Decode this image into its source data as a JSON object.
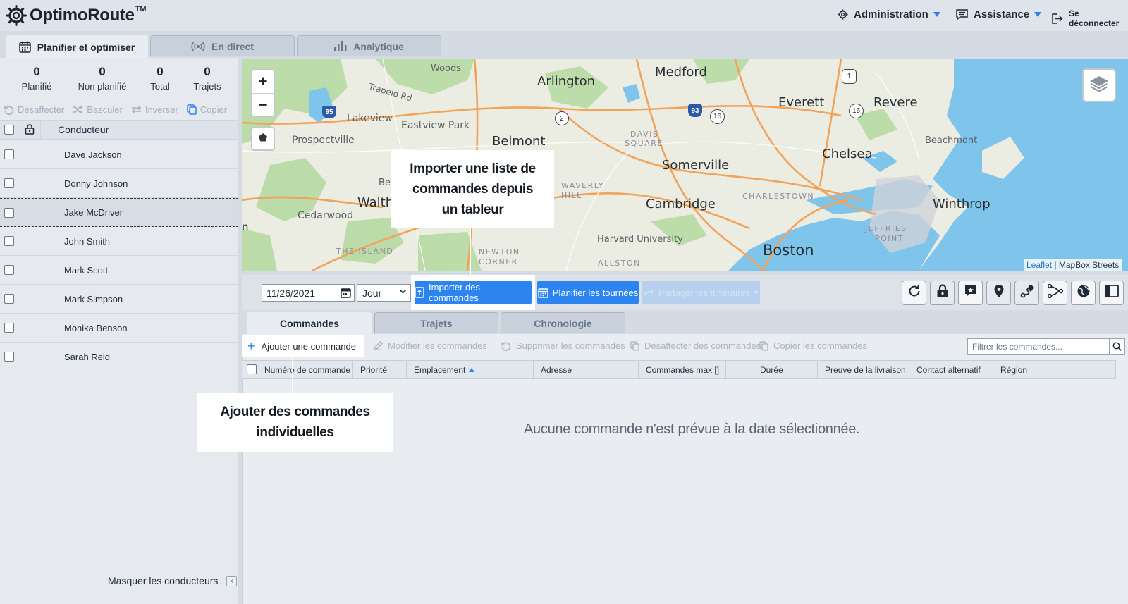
{
  "app": {
    "name": "OptimoRoute",
    "tm": "TM"
  },
  "top_menu": {
    "administration": "Administration",
    "assistance": "Assistance",
    "logout": "Se déconnecter"
  },
  "main_tabs": [
    {
      "label": "Planifier et optimiser",
      "active": true
    },
    {
      "label": "En direct",
      "active": false
    },
    {
      "label": "Analytique",
      "active": false
    }
  ],
  "stats": [
    {
      "value": "0",
      "label": "Planifié"
    },
    {
      "value": "0",
      "label": "Non planifié"
    },
    {
      "value": "0",
      "label": "Total"
    },
    {
      "value": "0",
      "label": "Trajets"
    }
  ],
  "driver_actions": {
    "unassign": "Désaffecter",
    "toggle": "Basculer",
    "invert": "Inverser",
    "copy": "Copier"
  },
  "drivers_header": "Conducteur",
  "drivers": [
    {
      "name": "Dave Jackson"
    },
    {
      "name": "Donny Johnson"
    },
    {
      "name": "Jake McDriver"
    },
    {
      "name": "John Smith"
    },
    {
      "name": "Mark Scott"
    },
    {
      "name": "Mark Simpson"
    },
    {
      "name": "Monika Benson"
    },
    {
      "name": "Sarah Reid"
    }
  ],
  "hide_drivers": "Masquer les conducteurs",
  "map": {
    "labels": {
      "woods": "Woods",
      "arlington": "Arlington",
      "medford": "Medford",
      "everett": "Everett",
      "revere": "Revere",
      "lakeview": "Lakeview",
      "eastview": "Eastview Park",
      "belmont": "Belmont",
      "davis": "DAVIS",
      "square": "SQUARE",
      "chelsea": "Chelsea",
      "beachmont": "Beachmont",
      "prospectville": "Prospectville",
      "somerville": "Somerville",
      "ber": "Ber",
      "waverly": "WAVERLY",
      "hill": "HILL",
      "walth": "Walth",
      "charlestown": "CHARLESTOWN",
      "cambridge": "Cambridge",
      "winthrop": "Winthrop",
      "jeffries": "JEFFRIES",
      "point": "POINT",
      "cedarwood": "Cedarwood",
      "harvard": "Harvard University",
      "island": "THE ISLAND",
      "newton": "NEWTON",
      "corner": "CORNER",
      "allston": "ALLSTON",
      "boston": "Boston",
      "trapelo": "Trapelo Rd",
      "n": "n",
      "shield_95": "95",
      "shield_93": "93",
      "shield_2": "2",
      "shield_16a": "16",
      "shield_16b": "16",
      "shield_1": "1"
    },
    "zoom_in": "+",
    "zoom_out": "−",
    "attribution_link": "Leaflet",
    "attribution_text": " | MapBox Streets"
  },
  "toolbar": {
    "date": "11/26/2021",
    "period": "Jour",
    "import_orders": "Importer des commandes",
    "plan_routes": "Planifier les tournées",
    "share_routes": "Partager les itinéraires"
  },
  "sub_tabs": [
    {
      "label": "Commandes",
      "active": true
    },
    {
      "label": "Trajets",
      "active": false
    },
    {
      "label": "Chronologie",
      "active": false
    }
  ],
  "order_actions": {
    "add": "Ajouter une commande",
    "edit": "Modifier les commandes",
    "delete": "Supprimer les commandes",
    "unassign": "Désaffecter des commandes",
    "copy": "Copier les commandes"
  },
  "filter_placeholder": "Filtrer les commandes...",
  "columns": [
    "Numéro de commande",
    "Priorité",
    "Emplacement",
    "Adresse",
    "Commandes max []",
    "Durée",
    "Preuve de la livraison",
    "Contact alternatif",
    "Région"
  ],
  "empty_message": "Aucune commande n'est prévue à la date sélectionnée.",
  "callouts": {
    "import": "Importer une liste de commandes depuis un tableur",
    "add": "Ajouter des commandes individuelles"
  },
  "colors": {
    "accent": "#2c84f1",
    "water": "#7fc3ea",
    "park": "#b7d9a6",
    "road": "#f3a25a"
  }
}
